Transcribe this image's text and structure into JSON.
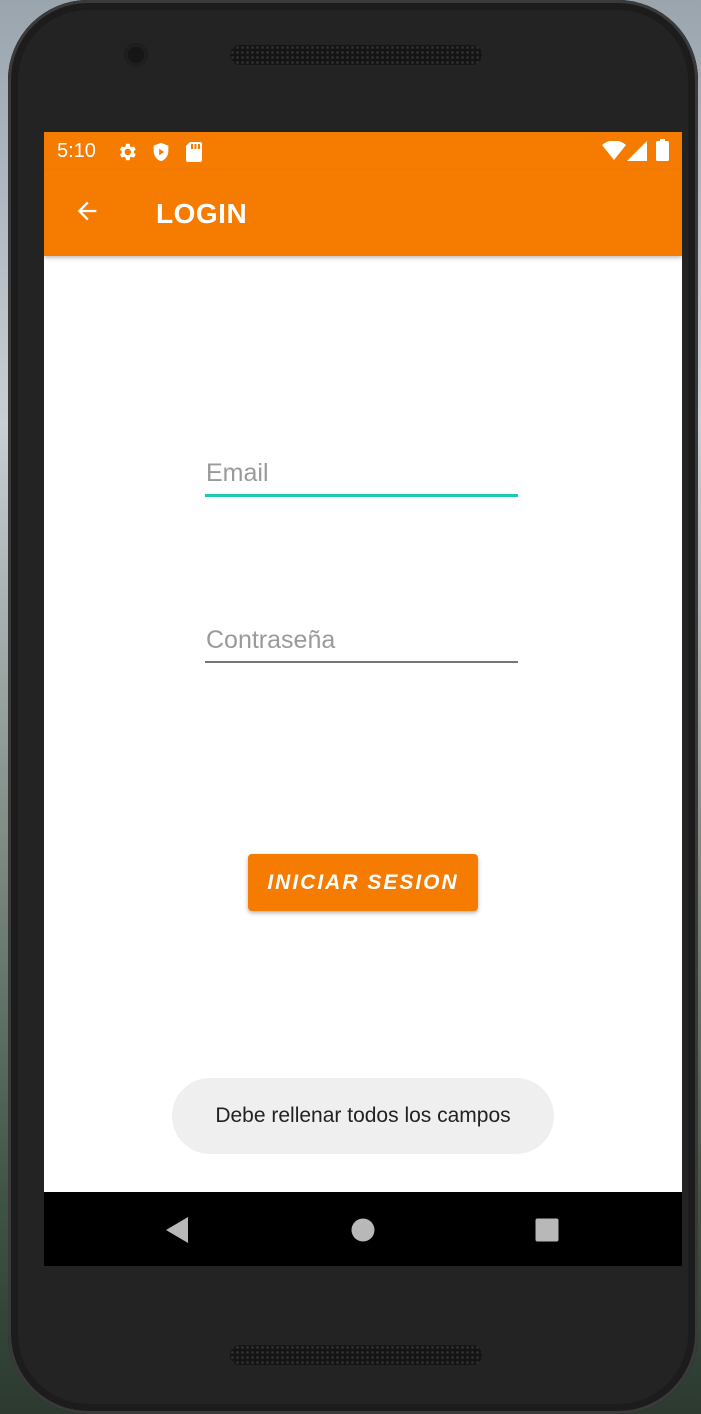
{
  "status_bar": {
    "time": "5:10",
    "left_icons": [
      "gear-icon",
      "shield-play-icon",
      "sd-card-icon"
    ],
    "right_icons": [
      "wifi-icon",
      "cell-signal-icon",
      "battery-icon"
    ]
  },
  "app_bar": {
    "title": "LOGIN",
    "back_icon": "arrow-back-icon"
  },
  "form": {
    "email_placeholder": "Email",
    "email_value": "",
    "password_placeholder": "Contraseña",
    "password_value": "",
    "submit_label": "INICIAR SESION"
  },
  "toast": {
    "message": "Debe rellenar todos los campos"
  },
  "nav_bar": {
    "buttons": [
      "back-triangle-icon",
      "home-circle-icon",
      "recents-square-icon"
    ]
  },
  "colors": {
    "accent": "#f57c00",
    "focus_underline": "#1ec8b8",
    "toast_bg": "#efefef"
  }
}
